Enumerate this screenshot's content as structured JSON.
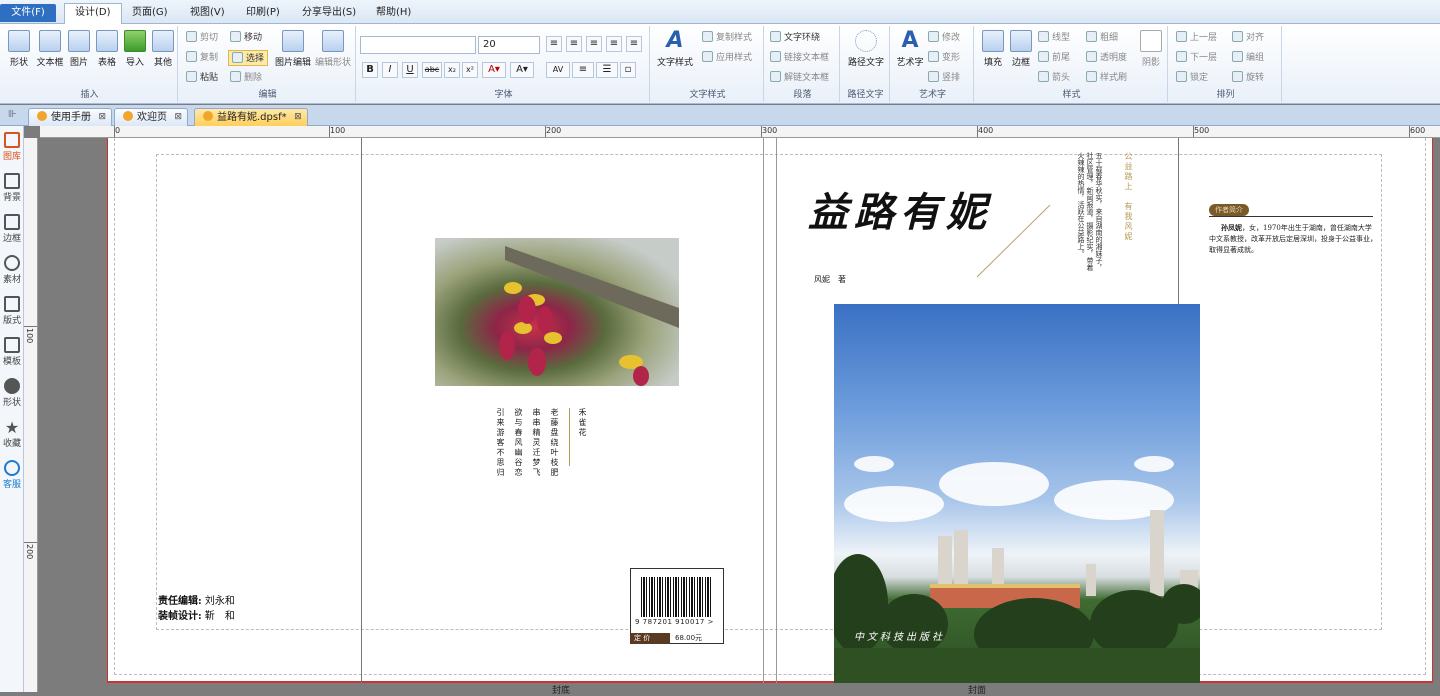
{
  "menu": {
    "file": "文件(F)",
    "items": [
      "设计(D)",
      "页面(G)",
      "视图(V)",
      "印刷(P)",
      "分享导出(S)",
      "帮助(H)"
    ]
  },
  "ribbon": {
    "insert": {
      "label": "插入",
      "buttons": [
        "形状",
        "文本框",
        "图片",
        "表格",
        "导入",
        "其他"
      ]
    },
    "edit": {
      "label": "编辑",
      "cut": "剪切",
      "move": "移动",
      "copy": "复制",
      "select": "选择",
      "paste": "粘贴",
      "delete": "删除",
      "picedit": "图片编辑",
      "shapeedit": "编辑形状"
    },
    "font": {
      "label": "字体",
      "font_value": "",
      "size_value": "20",
      "bold": "B",
      "italic": "I",
      "underline": "U",
      "strike": "abc"
    },
    "textstyle": {
      "label": "文字样式",
      "big": "文字样式",
      "copy": "复制样式",
      "apply": "应用样式"
    },
    "paragraph": {
      "label": "段落",
      "wrap": "文字环绕",
      "link": "链接文本框",
      "unlink": "解链文本框"
    },
    "pathtext": {
      "label": "路径文字",
      "big": "路径文字"
    },
    "arttext": {
      "label": "艺术字",
      "big": "艺术字",
      "modify": "修改",
      "transform": "变形",
      "vertical": "竖排"
    },
    "style": {
      "label": "样式",
      "fill": "填充",
      "border": "边框",
      "line": "线型",
      "weight": "粗细",
      "front": "前尾",
      "transparency": "透明度",
      "arrow": "箭头",
      "brush": "样式刷",
      "shadow": "阴影"
    },
    "arrange": {
      "label": "排列",
      "up": "上一层",
      "align": "对齐",
      "down": "下一层",
      "group": "编组",
      "lock": "锁定",
      "rotate": "旋转"
    }
  },
  "tabs": [
    {
      "label": "使用手册",
      "active": false
    },
    {
      "label": "欢迎页",
      "active": false
    },
    {
      "label": "益路有妮.dpsf*",
      "active": true
    }
  ],
  "leftpanel": [
    "图库",
    "背景",
    "边框",
    "素材",
    "版式",
    "模板",
    "形状",
    "收藏",
    "客服"
  ],
  "ruler": {
    "h": [
      "0",
      "100",
      "200",
      "300",
      "400",
      "500",
      "600"
    ],
    "v": [
      "100",
      "200"
    ]
  },
  "back_cover": {
    "poem_right": [
      "老藤盘绕叶枝肥",
      "串串精灵迁梦飞",
      "欲与春风幽谷恋",
      "引来游客不思归"
    ],
    "poem_title": "禾雀花",
    "editor_label": "责任编辑:",
    "editor": "刘永和",
    "designer_label": "装帧设计:",
    "designer": "靳　和",
    "isbn": "9 787201 910017 >",
    "price_label": "定 价",
    "price": "68.00元",
    "footer": "封底"
  },
  "front_cover": {
    "title": "益路有妮",
    "author": "风妮　著",
    "vertical_quote": "五十载春华秋实，来自湖南的湘妹子，社区管理，新闻报道，摄影纪实，带着火辣辣的热情，活跃在公益路上。",
    "vertical_slogan": "公益路上　有我风妮",
    "author_box_title": "作者简介",
    "author_bio_name": "孙凤妮",
    "author_bio": "，女，1970年出生于湖南，曾任湖南大学中文系教授，改革开放后定居深圳，投身于公益事业，取得显著成就。",
    "publisher": "中文科技出版社",
    "footer": "封面"
  },
  "colors": {
    "accent": "#2f6fc1",
    "page_border": "#cc3333",
    "tab_active": "#ffcf5a"
  }
}
